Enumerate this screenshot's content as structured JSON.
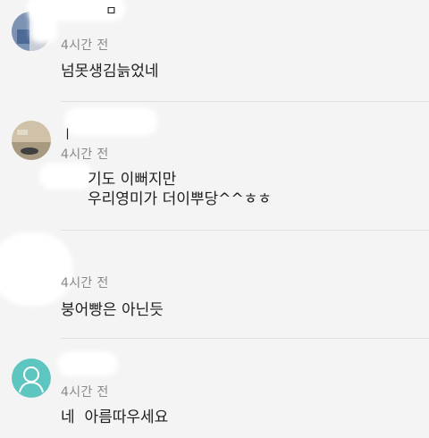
{
  "comments": [
    {
      "name_fragment": "ㅁ",
      "time": "4시간 전",
      "text": "넘못생김늙었네"
    },
    {
      "name_fragment": "ㅣ",
      "time": "4시간 전",
      "text": "기도 이뻐지만\n우리영미가 더이뿌당^^ㅎㅎ"
    },
    {
      "time": "4시간 전",
      "text": "붕어빵은 아닌듯"
    },
    {
      "time": "4시간 전",
      "text": "네  아름따우세요"
    }
  ],
  "colors": {
    "background": "#f4f4f4",
    "default_avatar": "#5ec6c0"
  }
}
